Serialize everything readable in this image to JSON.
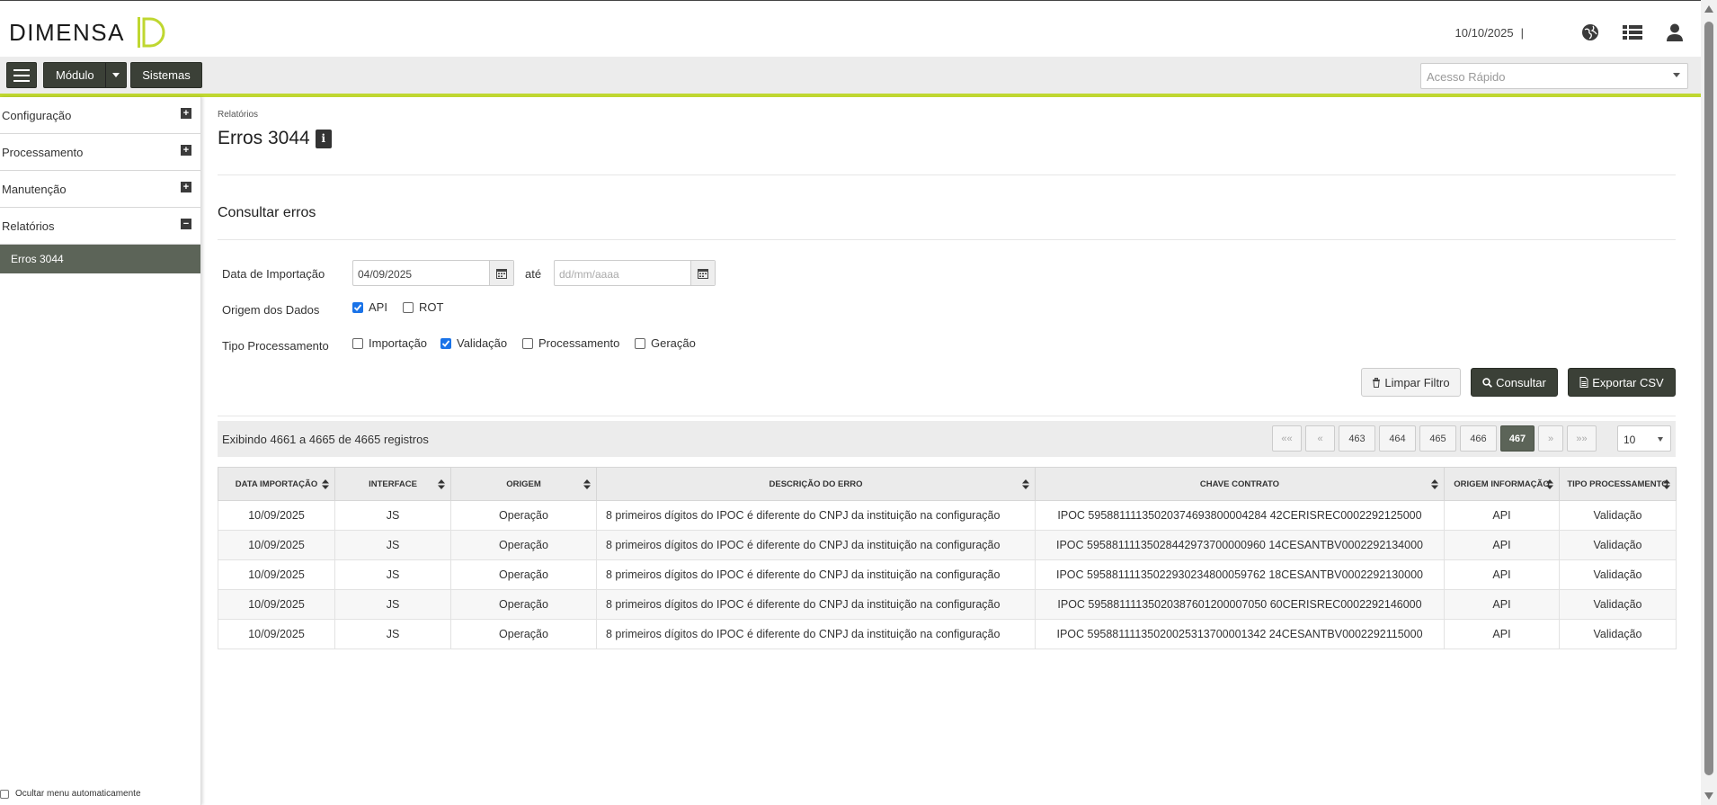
{
  "brand": {
    "logo_text": "DIMENSA",
    "accent": "#bfd730",
    "dark": "#3b4037"
  },
  "header": {
    "date": "10/10/2025",
    "separator": "|"
  },
  "toolbar": {
    "modulo_label": "Módulo",
    "sistemas_label": "Sistemas",
    "quick_access_placeholder": "Acesso Rápido"
  },
  "sidebar": {
    "items": [
      {
        "label": "Configuração",
        "state": "+"
      },
      {
        "label": "Processamento",
        "state": "+"
      },
      {
        "label": "Manutenção",
        "state": "+"
      },
      {
        "label": "Relatórios",
        "state": "−"
      }
    ],
    "subitem": "Erros 3044",
    "auto_hide_label": "Ocultar menu automaticamente"
  },
  "page": {
    "breadcrumb": "Relatórios",
    "title": "Erros 3044",
    "section_title": "Consultar erros"
  },
  "form": {
    "date_label": "Data de Importação",
    "date_from": "04/09/2025",
    "ate_label": "até",
    "date_to_placeholder": "dd/mm/aaaa",
    "origem_label": "Origem dos Dados",
    "origem_options": [
      {
        "label": "API",
        "checked": true
      },
      {
        "label": "ROT",
        "checked": false
      }
    ],
    "tipo_label": "Tipo Processamento",
    "tipo_options": [
      {
        "label": "Importação",
        "checked": false
      },
      {
        "label": "Validação",
        "checked": true
      },
      {
        "label": "Processamento",
        "checked": false
      },
      {
        "label": "Geração",
        "checked": false
      }
    ],
    "btn_limpar": "Limpar Filtro",
    "btn_consultar": "Consultar",
    "btn_exportar": "Exportar CSV"
  },
  "results": {
    "info": "Exibindo 4661 a 4665 de 4665 registros",
    "pager": {
      "first": "««",
      "prev": "«",
      "pages": [
        "463",
        "464",
        "465",
        "466",
        "467"
      ],
      "active": "467",
      "next": "»",
      "last": "»»"
    },
    "page_size": "10",
    "columns": [
      "DATA IMPORTAÇÃO",
      "INTERFACE",
      "ORIGEM",
      "DESCRIÇÃO DO ERRO",
      "CHAVE CONTRATO",
      "ORIGEM INFORMAÇÃO",
      "TIPO PROCESSAMENTO"
    ],
    "rows": [
      [
        "10/09/2025",
        "JS",
        "Operação",
        "8 primeiros dígitos do IPOC é diferente do CNPJ da instituição na configuração",
        "IPOC 59588111135020374693800004284 42CERISREC0002292125000",
        "API",
        "Validação"
      ],
      [
        "10/09/2025",
        "JS",
        "Operação",
        "8 primeiros dígitos do IPOC é diferente do CNPJ da instituição na configuração",
        "IPOC 59588111135028442973700000960 14CESANTBV0002292134000",
        "API",
        "Validação"
      ],
      [
        "10/09/2025",
        "JS",
        "Operação",
        "8 primeiros dígitos do IPOC é diferente do CNPJ da instituição na configuração",
        "IPOC 59588111135022930234800059762 18CESANTBV0002292130000",
        "API",
        "Validação"
      ],
      [
        "10/09/2025",
        "JS",
        "Operação",
        "8 primeiros dígitos do IPOC é diferente do CNPJ da instituição na configuração",
        "IPOC 59588111135020387601200007050 60CERISREC0002292146000",
        "API",
        "Validação"
      ],
      [
        "10/09/2025",
        "JS",
        "Operação",
        "8 primeiros dígitos do IPOC é diferente do CNPJ da instituição na configuração",
        "IPOC 59588111135020025313700001342 24CESANTBV0002292115000",
        "API",
        "Validação"
      ]
    ]
  }
}
